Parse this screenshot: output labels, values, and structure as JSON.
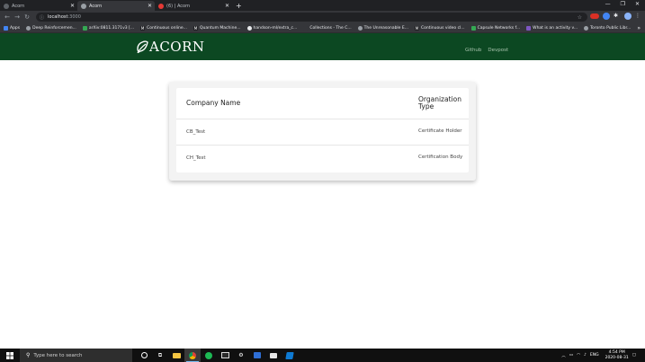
{
  "browser": {
    "tabs": [
      {
        "title": "Acorn",
        "active": false,
        "favicon_color": "#5f6368"
      },
      {
        "title": "Acorn",
        "active": true,
        "favicon_color": "#9aa0a6"
      },
      {
        "title": "(6) | Acorn",
        "active": false,
        "favicon_color": "#e53935"
      }
    ],
    "new_tab_label": "+",
    "url_host": "localhost",
    "url_port": ":3000",
    "bookmarks": [
      {
        "label": "Apps",
        "color": "#4285f4"
      },
      {
        "label": "Deep Reinforcemen...",
        "color": "#9aa0a6"
      },
      {
        "label": "arXiv:0811.3171v3 [...",
        "color": "#34a853"
      },
      {
        "label": "Continuous online...",
        "color": "#202124"
      },
      {
        "label": "Quantum Machine...",
        "color": "#202124"
      },
      {
        "label": "handson-ml/extra_c...",
        "color": "#e8eaed"
      },
      {
        "label": "Collections - The C...",
        "color": "#35363a"
      },
      {
        "label": "The Unreasonable E...",
        "color": "#9aa0a6"
      },
      {
        "label": "Continuous video cl...",
        "color": "#202124"
      },
      {
        "label": "Capsule Networks f...",
        "color": "#34a853"
      },
      {
        "label": "What is an activity v...",
        "color": "#7e57c2"
      },
      {
        "label": "Toronto Public Libr...",
        "color": "#9aa0a6"
      }
    ],
    "bookmarks_more": "»"
  },
  "header": {
    "brand": "ACORN",
    "links": [
      "Github",
      "Devpost"
    ],
    "background": "#0c4822"
  },
  "table": {
    "columns": [
      "Company Name",
      "Organization Type"
    ],
    "rows": [
      {
        "company": "CB_Test",
        "type": "Certificate Holder"
      },
      {
        "company": "CH_Test",
        "type": "Certification Body"
      }
    ]
  },
  "taskbar": {
    "search_placeholder": "Type here to search",
    "language": "ENG",
    "time": "4:54 PM",
    "date": "2020-08-31"
  }
}
